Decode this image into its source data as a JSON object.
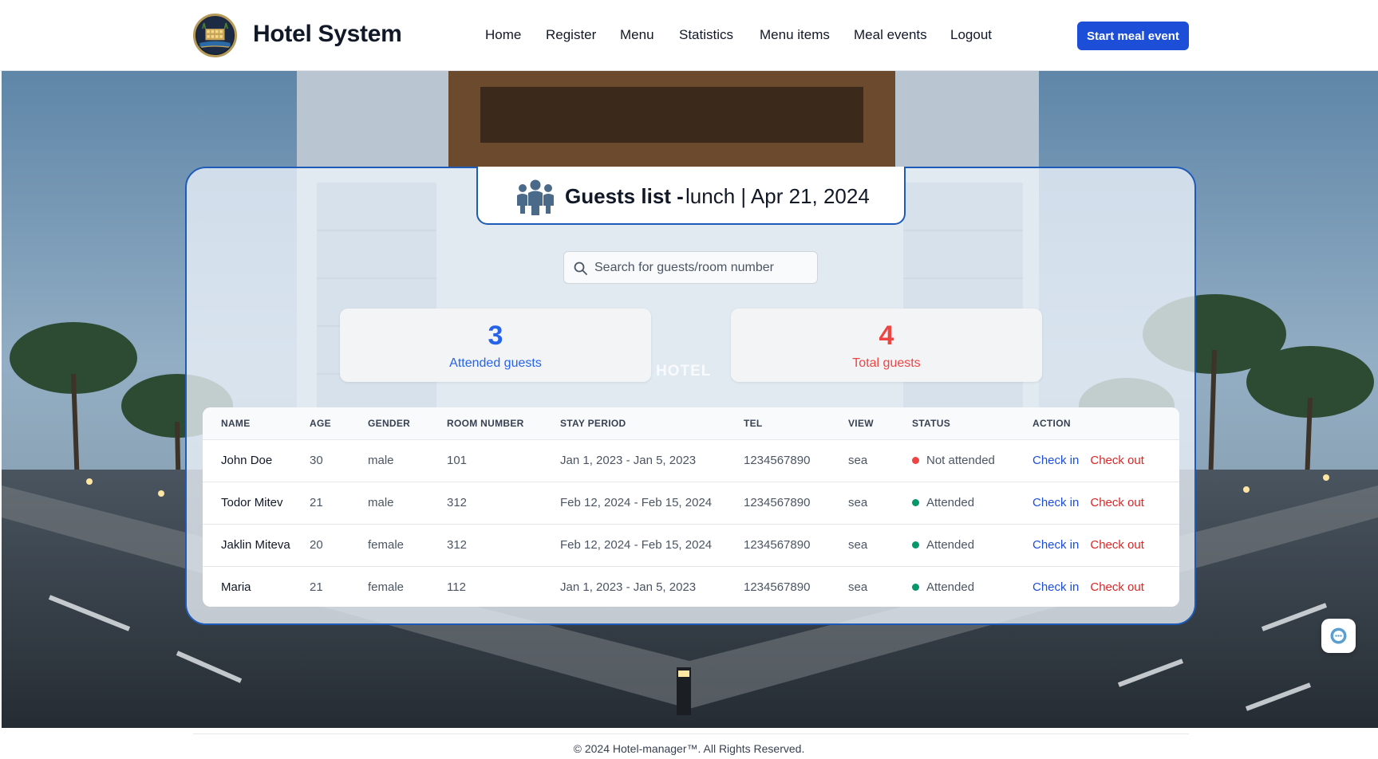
{
  "header": {
    "brand": "Hotel System",
    "nav": [
      {
        "label": "Home"
      },
      {
        "label": "Register"
      },
      {
        "label": "Menu"
      },
      {
        "label": "Statistics"
      },
      {
        "label": "Menu items"
      },
      {
        "label": "Meal events"
      },
      {
        "label": "Logout"
      }
    ],
    "cta_label": "Start meal event"
  },
  "guests": {
    "title": "Guests list -",
    "subtitle": "lunch | Apr 21, 2024",
    "search_placeholder": "Search for guests/room number",
    "stats": {
      "attended_value": "3",
      "attended_label": "Attended guests",
      "total_value": "4",
      "total_label": "Total guests"
    },
    "columns": [
      "Name",
      "Age",
      "Gender",
      "Room number",
      "Stay period",
      "Tel",
      "View",
      "Status",
      "Action"
    ],
    "rows": [
      {
        "name": "John Doe",
        "age": "30",
        "gender": "male",
        "room": "101",
        "stay": "Jan 1, 2023 - Jan 5, 2023",
        "tel": "1234567890",
        "view": "sea",
        "status": "Not attended",
        "status_color": "#ef4444",
        "check_in": "Check in",
        "check_out": "Check out"
      },
      {
        "name": "Todor Mitev",
        "age": "21",
        "gender": "male",
        "room": "312",
        "stay": "Feb 12, 2024 - Feb 15, 2024",
        "tel": "1234567890",
        "view": "sea",
        "status": "Attended",
        "status_color": "#059669",
        "check_in": "Check in",
        "check_out": "Check out"
      },
      {
        "name": "Jaklin Miteva",
        "age": "20",
        "gender": "female",
        "room": "312",
        "stay": "Feb 12, 2024 - Feb 15, 2024",
        "tel": "1234567890",
        "view": "sea",
        "status": "Attended",
        "status_color": "#059669",
        "check_in": "Check in",
        "check_out": "Check out"
      },
      {
        "name": "Maria",
        "age": "21",
        "gender": "female",
        "room": "112",
        "stay": "Jan 1, 2023 - Jan 5, 2023",
        "tel": "1234567890",
        "view": "sea",
        "status": "Attended",
        "status_color": "#059669",
        "check_in": "Check in",
        "check_out": "Check out"
      }
    ]
  },
  "background": {
    "sign": "HOTEL"
  },
  "footer": {
    "text": "© 2024 Hotel-manager™. All Rights Reserved."
  },
  "colors": {
    "accent": "#1d4ed8",
    "danger": "#ef4444",
    "success": "#059669",
    "card_border": "#1e5bb8"
  },
  "icons": {
    "logo": "hotel-logo-icon",
    "guests": "people-icon",
    "search": "search-icon",
    "chat": "chat-icon"
  }
}
